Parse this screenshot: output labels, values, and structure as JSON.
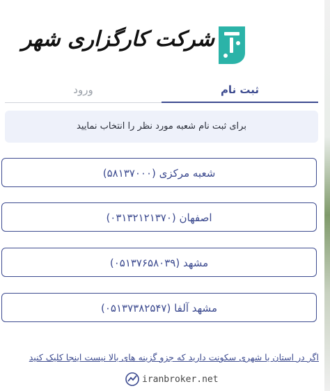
{
  "brand": {
    "name": "شرکت کارگزاری شهر",
    "accent": "#3c4a8f",
    "logo_teal": "#2bb3a8"
  },
  "tabs": [
    {
      "label": "ثبت نام",
      "active": true
    },
    {
      "label": "ورود",
      "active": false
    }
  ],
  "info": {
    "text": "برای ثبت نام شعبه مورد نظر را انتخاب نمایید"
  },
  "branches": [
    {
      "label": "شعبه مرکزی (۵۸۱۳۷۰۰۰)"
    },
    {
      "label": "اصفهان (۰۳۱۳۲۱۲۱۳۷۰)"
    },
    {
      "label": "مشهد (۰۵۱۳۷۶۵۸۰۳۹)"
    },
    {
      "label": "مشهد آلفا (۰۵۱۳۷۳۸۲۵۴۷)"
    }
  ],
  "footer": {
    "link_text": "اگر در استان یا شهری سکونت دارید که جزو گزینه های بالا نیست اینجا کلیک کنید"
  },
  "watermark": {
    "text": "iranbroker.net",
    "icon": "trend-chart-icon"
  }
}
